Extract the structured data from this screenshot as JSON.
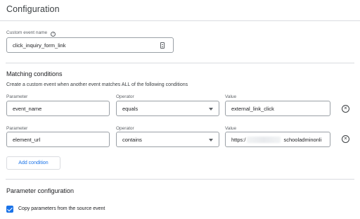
{
  "header": {
    "title": "Configuration"
  },
  "custom_event": {
    "label": "Custom event name",
    "help_icon": "help-circle-icon",
    "value": "click_inquiry_form_link",
    "trailing_icon": "document-icon"
  },
  "matching": {
    "heading": "Matching conditions",
    "description": "Create a custom event when another event matches ALL of the following conditions",
    "rows": [
      {
        "parameter_label": "Parameter",
        "parameter": "event_name",
        "operator_label": "Operator",
        "operator": "equals",
        "value_label": "Value",
        "value": "external_link_click",
        "remove_icon": "close-circle-icon"
      },
      {
        "parameter_label": "Parameter",
        "parameter": "element_url",
        "operator_label": "Operator",
        "operator": "contains",
        "value_label": "Value",
        "value_prefix": "https:/",
        "value_suffix": "schooladminonli",
        "remove_icon": "close-circle-icon"
      }
    ],
    "add_label": "Add condition"
  },
  "param_config": {
    "heading": "Parameter configuration",
    "copy_label": "Copy parameters from the source event",
    "copy_checked": true
  },
  "colors": {
    "accent": "#1a73e8",
    "border": "#9aa0a6",
    "divider": "#dadce0"
  }
}
